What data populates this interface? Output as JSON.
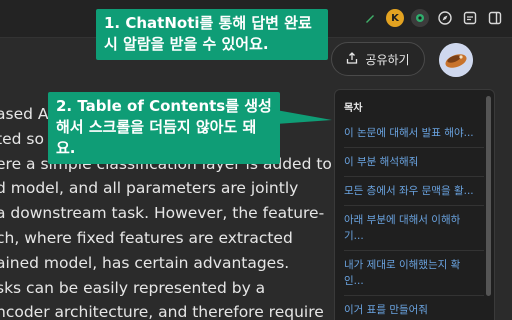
{
  "toolbar": {
    "icons": [
      "pen-icon",
      "k-extension-icon",
      "chatnoti-icon",
      "compass-icon",
      "extensions-icon",
      "sidebar-icon"
    ],
    "k_label": "K"
  },
  "header": {
    "share_label": "공유하기"
  },
  "reader": {
    "lines": [
      "ased Ap",
      "ted so far have used the fine-tuning",
      "ere a simple classification layer is added to",
      "d model, and all parameters are jointly",
      "a downstream task. However, the feature-",
      "ch, where fixed features are extracted",
      "ained model, has certain advantages.",
      "sks can be easily represented by a",
      "ncoder architecture, and therefore require"
    ]
  },
  "toc": {
    "title": "목차",
    "items": [
      "이 논문에 대해서 발표 해야...",
      "이 부분 해석해줘",
      "모든 층에서 좌우 문맥을 활...",
      "아래 부분에 대해서 이해하기...",
      "내가 제대로 이해했는지 확인...",
      "이거 표를 만들어줘"
    ]
  },
  "callouts": {
    "first": "1. ChatNoti를 통해 답변 완료 시 알람을 받을 수 있어요.",
    "second": "2. Table of Contents를 생성해서 스크롤을 더듬지 않아도 돼요."
  },
  "colors": {
    "callout": "#0f9d76",
    "link": "#6aa3e0",
    "background": "#2b2b2b"
  }
}
